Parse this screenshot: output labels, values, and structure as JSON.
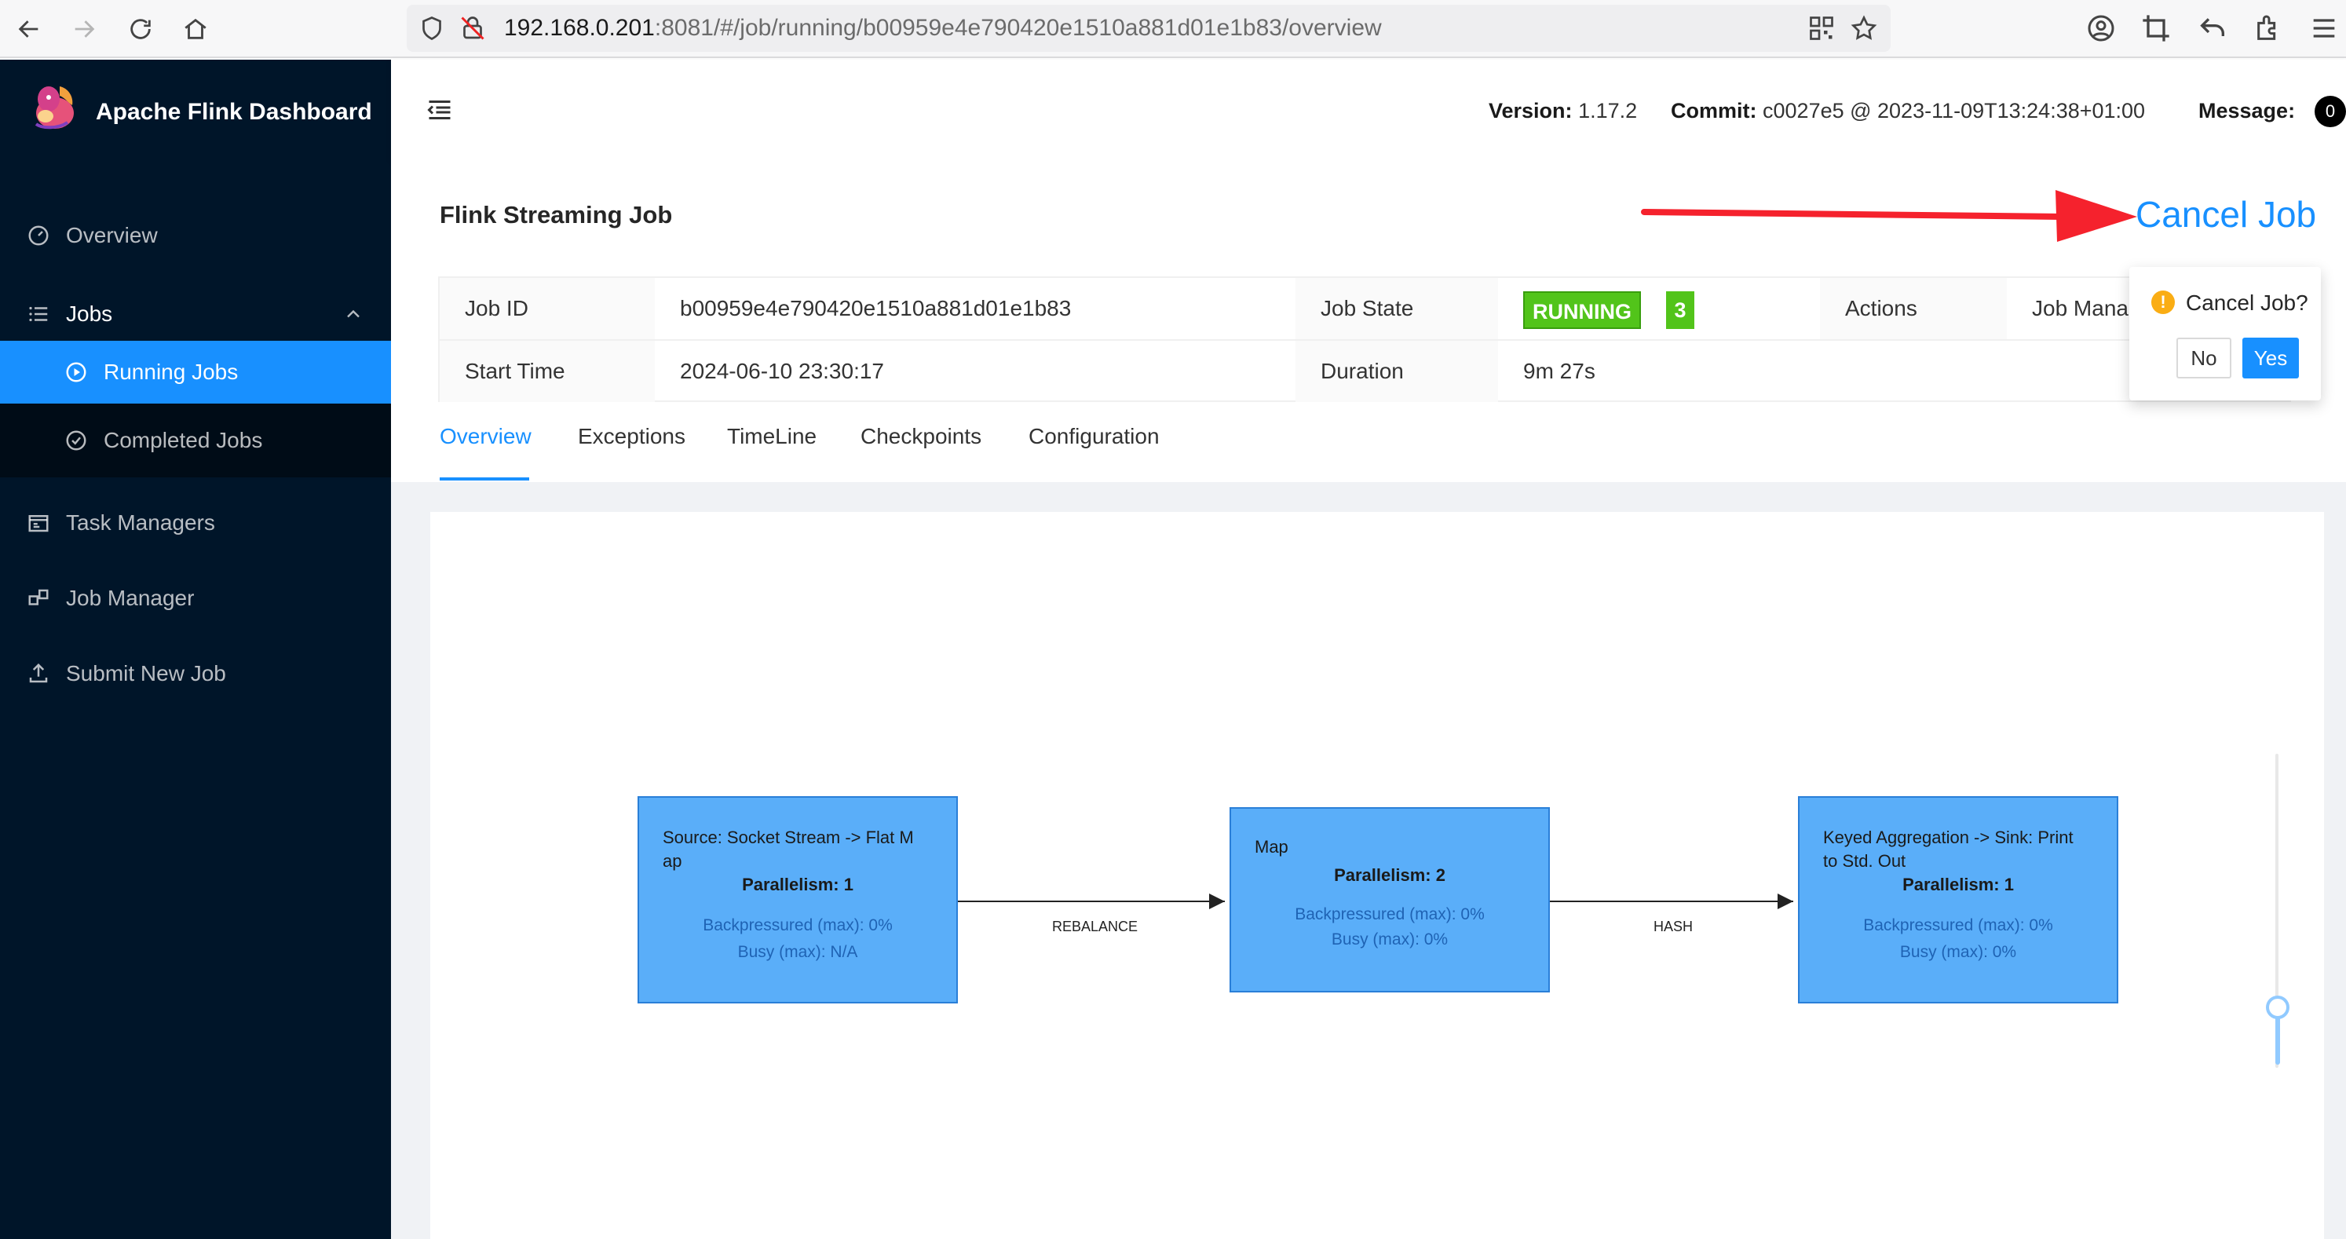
{
  "browser": {
    "url_host": "192.168.0.201",
    "url_rest": ":8081/#/job/running/b00959e4e790420e1510a881d01e1b83/overview"
  },
  "sidebar": {
    "brand": "Apache Flink Dashboard",
    "items": [
      {
        "label": "Overview",
        "icon": "dashboard-icon"
      },
      {
        "label": "Jobs",
        "icon": "list-icon"
      },
      {
        "label": "Running Jobs",
        "icon": "play-circle-icon"
      },
      {
        "label": "Completed Jobs",
        "icon": "check-circle-icon"
      },
      {
        "label": "Task Managers",
        "icon": "schedule-icon"
      },
      {
        "label": "Job Manager",
        "icon": "cluster-icon"
      },
      {
        "label": "Submit New Job",
        "icon": "upload-icon"
      }
    ]
  },
  "header": {
    "version_label": "Version:",
    "version_value": "1.17.2",
    "commit_label": "Commit:",
    "commit_value": "c0027e5 @ 2023-11-09T13:24:38+01:00",
    "message_label": "Message:",
    "message_count": "0"
  },
  "job": {
    "title": "Flink Streaming Job",
    "cancel_label": "Cancel Job",
    "id_label": "Job ID",
    "id_value": "b00959e4e790420e1510a881d01e1b83",
    "state_label": "Job State",
    "state_value": "RUNNING",
    "state_count": "3",
    "actions_label": "Actions",
    "actions_link": "Job Manag",
    "start_label": "Start Time",
    "start_value": "2024-06-10 23:30:17",
    "duration_label": "Duration",
    "duration_value": "9m 27s"
  },
  "popconfirm": {
    "title": "Cancel Job?",
    "no": "No",
    "yes": "Yes"
  },
  "tabs": [
    "Overview",
    "Exceptions",
    "TimeLine",
    "Checkpoints",
    "Configuration"
  ],
  "graph": {
    "nodes": [
      {
        "title_line1": "Source: Socket Stream -> Flat M",
        "title_line2": "ap",
        "parallelism": "Parallelism: 1",
        "backpressure": "Backpressured (max): 0%",
        "busy": "Busy (max): N/A"
      },
      {
        "title_line1": "Map",
        "title_line2": "",
        "parallelism": "Parallelism: 2",
        "backpressure": "Backpressured (max): 0%",
        "busy": "Busy (max): 0%"
      },
      {
        "title_line1": "Keyed Aggregation -> Sink: Print",
        "title_line2": "to Std. Out",
        "parallelism": "Parallelism: 1",
        "backpressure": "Backpressured (max): 0%",
        "busy": "Busy (max): 0%"
      }
    ],
    "edges": [
      "REBALANCE",
      "HASH"
    ]
  },
  "colors": {
    "sidebar_bg": "#001529",
    "accent": "#1890ff",
    "running": "#52c41a",
    "node_fill": "#5aaef9",
    "arrow": "#f5222d"
  }
}
